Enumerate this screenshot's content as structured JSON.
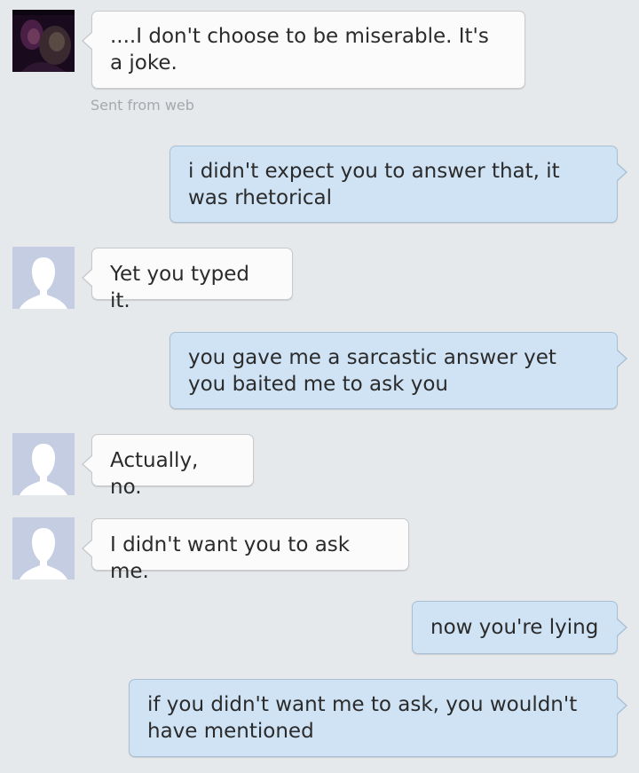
{
  "colors": {
    "background": "#e6e9ec",
    "incoming_bubble": "#fbfbfb",
    "outgoing_bubble": "#cfe3f5",
    "meta_text": "#a5a8ac"
  },
  "conversation": {
    "messages": [
      {
        "direction": "incoming",
        "avatar": "photo-avatar",
        "text": "....I don't choose to be miserable. It's a joke.",
        "meta": "Sent from web"
      },
      {
        "direction": "outgoing",
        "text": "i didn't expect you to answer that, it was rhetorical"
      },
      {
        "direction": "incoming",
        "avatar": "default-avatar-icon",
        "text": "Yet you typed it."
      },
      {
        "direction": "outgoing",
        "text": "you gave me a sarcastic answer yet you baited me to ask you"
      },
      {
        "direction": "incoming",
        "avatar": "default-avatar-icon",
        "text": "Actually, no."
      },
      {
        "direction": "incoming",
        "avatar": "default-avatar-icon",
        "text": "I didn't want you to ask me."
      },
      {
        "direction": "outgoing",
        "text": "now you're lying"
      },
      {
        "direction": "outgoing",
        "text": "if you didn't want me to ask, you wouldn't have mentioned"
      }
    ]
  }
}
